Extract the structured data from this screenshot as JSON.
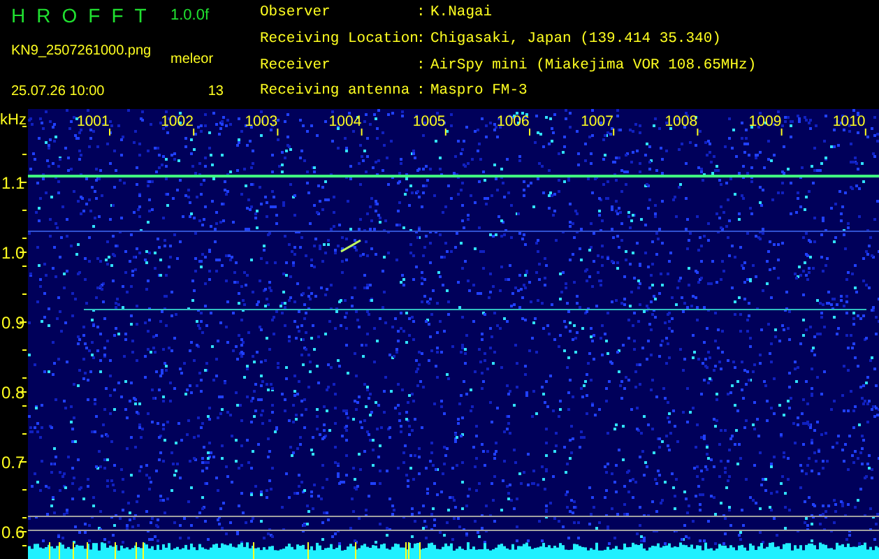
{
  "header": {
    "title_letters": [
      "H",
      "R",
      "O",
      "F",
      "F",
      "T"
    ],
    "version": "1.0.0f",
    "filename": "KN9_2507261000.png",
    "datetime": "25.07.26 10:00",
    "count_label": "meleor",
    "count": "13"
  },
  "info": [
    {
      "label": "Observer",
      "separator": ":",
      "value": "K.Nagai"
    },
    {
      "label": "Receiving Location",
      "separator": ":",
      "value": "Chigasaki, Japan (139.414 35.340)"
    },
    {
      "label": "Receiver",
      "separator": ":",
      "value": "AirSpy mini (Miakejima VOR 108.65MHz)"
    },
    {
      "label": "Receiving antenna",
      "separator": ":",
      "value": "Maspro FM-3"
    }
  ],
  "spectrogram": {
    "unit": "kHz",
    "x_labels": [
      "1001",
      "1002",
      "1003",
      "1004",
      "1005",
      "1006",
      "1007",
      "1008",
      "1009",
      "1010"
    ],
    "y_labels": [
      "1.1",
      "1.0",
      "0.9",
      "0.8",
      "0.7",
      "0.6"
    ]
  }
}
